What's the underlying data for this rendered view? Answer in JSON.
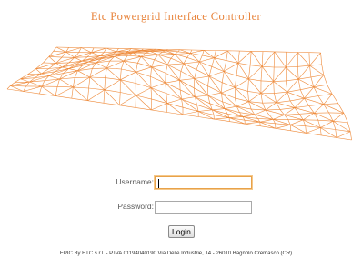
{
  "header": {
    "title": "Etc Powergrid Interface Controller"
  },
  "logo": {
    "icon": "orange-wireframe-mesh",
    "stroke_color": "#ee8a3a"
  },
  "login_form": {
    "username_label": "Username:",
    "username_value": "",
    "password_label": "Password:",
    "password_value": "",
    "submit_label": "Login"
  },
  "footer": {
    "text": "EPIC By ETC s.r.l. - P.IVA 01194040190 Via Delle Industrie, 14 - 26010 Bagnolo Cremasco (CR)"
  },
  "colors": {
    "accent": "#e8843c",
    "focus_border": "#e8a24a"
  }
}
